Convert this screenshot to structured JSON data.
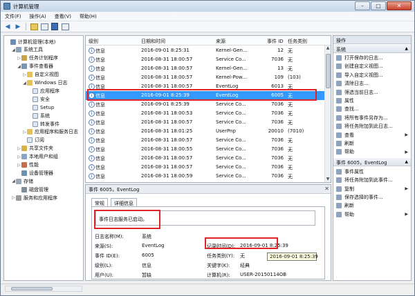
{
  "window": {
    "title": "计算机管理",
    "controls": [
      "–",
      "□",
      "✕"
    ]
  },
  "menu": [
    "文件(F)",
    "操作(A)",
    "查看(V)",
    "帮助(H)"
  ],
  "tree": [
    {
      "label": "计算机管理(本地)",
      "icon": "computer-icon",
      "arrow": "",
      "indent": 0
    },
    {
      "label": "系统工具",
      "icon": "tools-icon",
      "arrow": "◢",
      "indent": 1
    },
    {
      "label": "任务计划程序",
      "icon": "task-scheduler-icon",
      "arrow": "▷",
      "indent": 2
    },
    {
      "label": "事件查看器",
      "icon": "event-viewer-icon",
      "arrow": "◢",
      "indent": 2
    },
    {
      "label": "自定义视图",
      "icon": "folder-icon",
      "arrow": "▷",
      "indent": 3
    },
    {
      "label": "Windows 日志",
      "icon": "folder-icon",
      "arrow": "◢",
      "indent": 3
    },
    {
      "label": "应用程序",
      "icon": "log-icon",
      "arrow": "",
      "indent": 4
    },
    {
      "label": "安全",
      "icon": "log-icon",
      "arrow": "",
      "indent": 4
    },
    {
      "label": "Setup",
      "icon": "log-icon",
      "arrow": "",
      "indent": 4
    },
    {
      "label": "系统",
      "icon": "log-icon",
      "arrow": "",
      "indent": 4
    },
    {
      "label": "转发事件",
      "icon": "log-icon",
      "arrow": "",
      "indent": 4
    },
    {
      "label": "应用程序和服务日志",
      "icon": "folder-icon",
      "arrow": "▷",
      "indent": 3
    },
    {
      "label": "订阅",
      "icon": "log-icon",
      "arrow": "",
      "indent": 3
    },
    {
      "label": "共享文件夹",
      "icon": "shared-folder-icon",
      "arrow": "▷",
      "indent": 2
    },
    {
      "label": "本地用户和组",
      "icon": "users-icon",
      "arrow": "▷",
      "indent": 2
    },
    {
      "label": "性能",
      "icon": "performance-icon",
      "arrow": "▷",
      "indent": 2
    },
    {
      "label": "设备管理器",
      "icon": "device-manager-icon",
      "arrow": "",
      "indent": 2
    },
    {
      "label": "存储",
      "icon": "storage-icon",
      "arrow": "◢",
      "indent": 1
    },
    {
      "label": "磁盘管理",
      "icon": "disk-icon",
      "arrow": "",
      "indent": 2
    },
    {
      "label": "服务和应用程序",
      "icon": "services-icon",
      "arrow": "▷",
      "indent": 1
    }
  ],
  "events": {
    "columns": [
      "级别",
      "日期和时间",
      "来源",
      "事件 ID",
      "任务类别"
    ],
    "rows": [
      {
        "level": "信息",
        "datetime": "2016-09-01 8:25:31",
        "source": "Kernel-Gen...",
        "id": "12",
        "task": "无"
      },
      {
        "level": "信息",
        "datetime": "2016-08-31 18:00:57",
        "source": "Service Co...",
        "id": "7036",
        "task": "无"
      },
      {
        "level": "信息",
        "datetime": "2016-08-31 18:00:57",
        "source": "Kernel-Gen...",
        "id": "13",
        "task": "无"
      },
      {
        "level": "信息",
        "datetime": "2016-08-31 18:00:57",
        "source": "Kernel-Pow...",
        "id": "109",
        "task": "(103)"
      },
      {
        "level": "信息",
        "datetime": "2016-08-31 18:00:57",
        "source": "EventLog",
        "id": "6013",
        "task": "无"
      },
      {
        "level": "信息",
        "datetime": "2016-09-01 8:25:39",
        "source": "EventLog",
        "id": "6005",
        "task": "无"
      },
      {
        "level": "信息",
        "datetime": "2016-09-01 8:25:39",
        "source": "Service Co...",
        "id": "7036",
        "task": "无"
      },
      {
        "level": "信息",
        "datetime": "2016-08-31 18:00:53",
        "source": "Service Co...",
        "id": "7036",
        "task": "无"
      },
      {
        "level": "信息",
        "datetime": "2016-08-31 18:00:57",
        "source": "Service Co...",
        "id": "7036",
        "task": "无"
      },
      {
        "level": "信息",
        "datetime": "2016-08-31 18:01:25",
        "source": "UserPnp",
        "id": "20010",
        "task": "(7010)"
      },
      {
        "level": "信息",
        "datetime": "2016-08-31 18:00:57",
        "source": "Service Co...",
        "id": "7036",
        "task": "无"
      },
      {
        "level": "信息",
        "datetime": "2016-08-31 18:00:55",
        "source": "Service Co...",
        "id": "7036",
        "task": "无"
      },
      {
        "level": "信息",
        "datetime": "2016-08-31 18:00:57",
        "source": "Service Co...",
        "id": "7036",
        "task": "无"
      },
      {
        "level": "信息",
        "datetime": "2016-08-31 18:00:57",
        "source": "Service Co...",
        "id": "7036",
        "task": "无"
      },
      {
        "level": "信息",
        "datetime": "2016-08-31 18:00:59",
        "source": "Service Co...",
        "id": "7036",
        "task": "无"
      }
    ],
    "selected_index": 5
  },
  "detail": {
    "header": "事件 6005，EventLog",
    "tabs": [
      "常规",
      "详细信息"
    ],
    "message": "事件日志服务已启动。",
    "log_name_label": "日志名称(M):",
    "log_name_value": "系统",
    "source_label": "来源(S):",
    "source_value": "EventLog",
    "logged_label": "记录时间(D):",
    "logged_value": "2016-09-01 8:25:39",
    "event_id_label": "事件 ID(E):",
    "event_id_value": "6005",
    "task_label": "任务类别(Y):",
    "task_value": "无",
    "level_label": "级别(L):",
    "level_value": "信息",
    "keywords_label": "关键字(K):",
    "keywords_value": "经典",
    "user_label": "用户(U):",
    "user_value": "暂缺",
    "computer_label": "计算机(R):",
    "computer_value": "USER-20150114OB",
    "tooltip": "2016-09-01 8:25:39"
  },
  "actions": {
    "title": "操作",
    "section1": "系统",
    "items1": [
      {
        "label": "打开保存的日志...",
        "icon": "open-log-icon",
        "sub": false
      },
      {
        "label": "创建自定义视图...",
        "icon": "filter-icon",
        "sub": false
      },
      {
        "label": "导入自定义视图...",
        "icon": "import-icon",
        "sub": false
      },
      {
        "label": "清除日志...",
        "icon": "clear-log-icon",
        "sub": false
      },
      {
        "label": "筛选当前日志...",
        "icon": "filter-icon",
        "sub": false
      },
      {
        "label": "属性",
        "icon": "properties-icon",
        "sub": false
      },
      {
        "label": "查找...",
        "icon": "find-icon",
        "sub": false
      },
      {
        "label": "将所有事件另存为...",
        "icon": "save-icon",
        "sub": false
      },
      {
        "label": "将任务附加到此日志...",
        "icon": "attach-task-icon",
        "sub": false
      },
      {
        "label": "查看",
        "icon": "view-icon",
        "sub": true
      },
      {
        "label": "刷新",
        "icon": "refresh-icon",
        "sub": false
      },
      {
        "label": "帮助",
        "icon": "help-icon",
        "sub": true
      }
    ],
    "section2": "事件 6005，EventLog",
    "items2": [
      {
        "label": "事件属性",
        "icon": "event-properties-icon",
        "sub": false
      },
      {
        "label": "将任务附加到此事件...",
        "icon": "attach-task-icon",
        "sub": false
      },
      {
        "label": "复制",
        "icon": "copy-icon",
        "sub": true
      },
      {
        "label": "保存选择的事件...",
        "icon": "save-icon",
        "sub": false
      },
      {
        "label": "刷新",
        "icon": "refresh-icon",
        "sub": false
      },
      {
        "label": "帮助",
        "icon": "help-icon",
        "sub": true
      }
    ]
  },
  "colors": {
    "selection": "#3399ff",
    "highlight": "#e0232a"
  }
}
